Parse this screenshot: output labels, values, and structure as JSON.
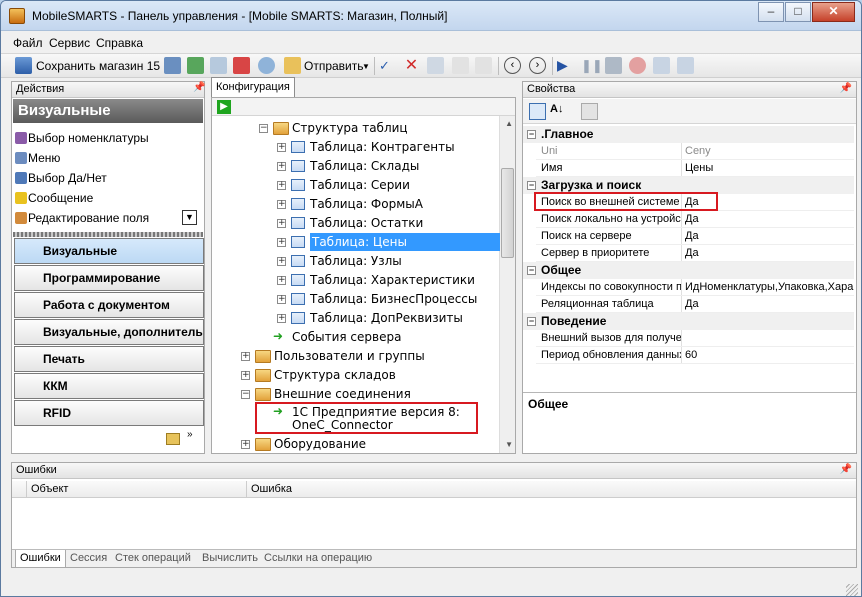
{
  "window": {
    "title": "MobileSMARTS - Панель управления - [Mobile SMARTS: Магазин, Полный]"
  },
  "menu": [
    "Файл",
    "Сервис",
    "Справка"
  ],
  "toolbar": {
    "save_label": "Сохранить магазин 15",
    "send_label": "Отправить"
  },
  "actions_panel": {
    "title": "Действия",
    "group_header": "Визуальные",
    "items": [
      "Выбор номенклатуры",
      "Меню",
      "Выбор Да/Нет",
      "Сообщение",
      "Редактирование поля"
    ],
    "nav_buttons": [
      "Визуальные",
      "Программирование",
      "Работа с документом",
      "Визуальные, дополнительн",
      "Печать",
      "ККМ",
      "RFID"
    ]
  },
  "config_panel": {
    "tab": "Конфигурация",
    "tree": [
      {
        "label": "Структура таблиц",
        "kind": "folder",
        "expanded": true
      },
      {
        "label": "Таблица: Контрагенты",
        "kind": "table"
      },
      {
        "label": "Таблица: Склады",
        "kind": "table"
      },
      {
        "label": "Таблица: Серии",
        "kind": "table"
      },
      {
        "label": "Таблица: ФормыА",
        "kind": "table"
      },
      {
        "label": "Таблица: Остатки",
        "kind": "table"
      },
      {
        "label": "Таблица: Цены",
        "kind": "table",
        "selected": true
      },
      {
        "label": "Таблица: Узлы",
        "kind": "table"
      },
      {
        "label": "Таблица: Характеристики",
        "kind": "table"
      },
      {
        "label": "Таблица: БизнесПроцессы",
        "kind": "table"
      },
      {
        "label": "Таблица: ДопРеквизиты",
        "kind": "table"
      },
      {
        "label": "События сервера",
        "kind": "event"
      },
      {
        "label": "Пользователи и группы",
        "kind": "folder"
      },
      {
        "label": "Структура складов",
        "kind": "folder"
      },
      {
        "label": "Внешние соединения",
        "kind": "folder",
        "expanded": true
      },
      {
        "label": "1С Предприятие версия 8:",
        "kind": "connector",
        "sublabel": "OneC_Connector"
      },
      {
        "label": "Оборудование",
        "kind": "folder"
      }
    ]
  },
  "props_panel": {
    "title": "Свойства",
    "categories": [
      {
        "name": ".Главное",
        "rows": [
          [
            "Uni",
            "Ceny"
          ],
          [
            "Имя",
            "Цены"
          ]
        ]
      },
      {
        "name": "Загрузка и поиск",
        "rows": [
          [
            "Поиск во внешней системе",
            "Да"
          ],
          [
            "Поиск локально на устройс",
            "Да"
          ],
          [
            "Поиск на сервере",
            "Да"
          ],
          [
            "Сервер в приоритете",
            "Да"
          ]
        ]
      },
      {
        "name": "Общее",
        "rows": [
          [
            "Индексы по совокупности п",
            "ИдНоменклатуры,Упаковка,Харак"
          ],
          [
            "Реляционная таблица",
            "Да"
          ]
        ]
      },
      {
        "name": "Поведение",
        "rows": [
          [
            "Внешний вызов для получе",
            ""
          ],
          [
            "Период обновления данных",
            "60"
          ]
        ]
      }
    ],
    "description_title": "Общее"
  },
  "errors_panel": {
    "title": "Ошибки",
    "columns": [
      "Объект",
      "Ошибка"
    ],
    "tabs": [
      "Ошибки",
      "Сессия",
      "Стек операций",
      "Вычислить",
      "Ссылки на операцию"
    ]
  },
  "colors": {
    "selection": "#3399ff",
    "highlight_box": "#d71920",
    "nav_selected": "#c8e1f8"
  }
}
